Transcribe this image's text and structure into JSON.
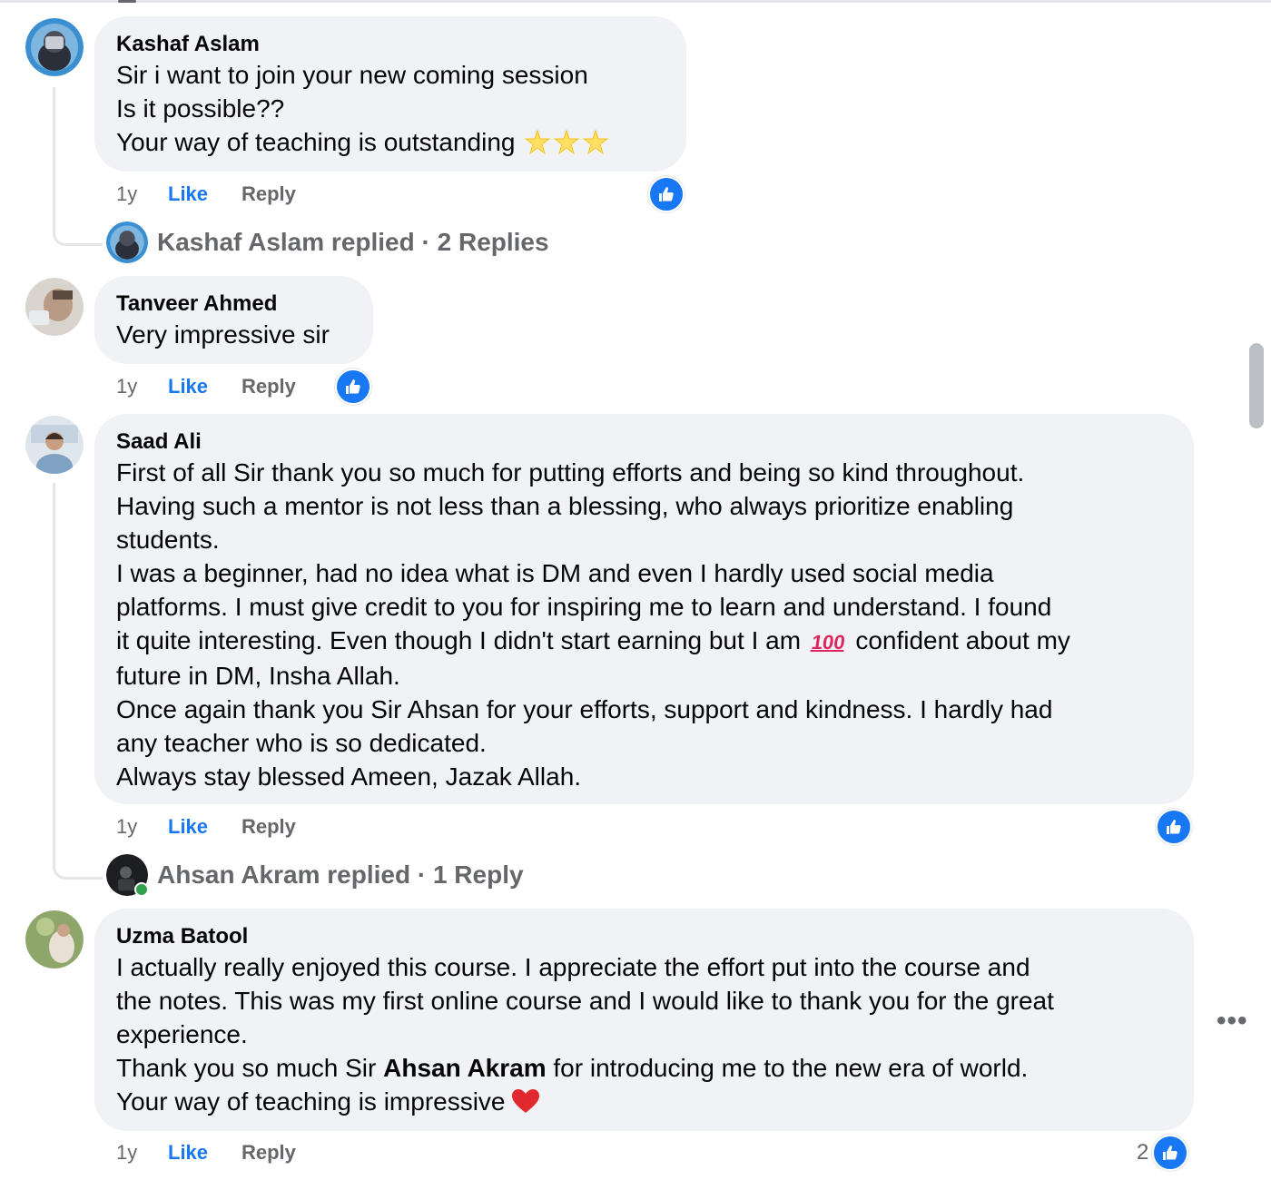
{
  "comments": [
    {
      "author": "Kashaf Aslam",
      "lines": [
        "Sir i want to join your new coming session",
        "Is it possible??",
        "Your way of teaching is outstanding"
      ],
      "time": "1y",
      "like": "Like",
      "reply": "Reply",
      "replies_summary": "Kashaf Aslam replied · 2 Replies"
    },
    {
      "author": "Tanveer Ahmed",
      "lines": [
        "Very impressive sir"
      ],
      "time": "1y",
      "like": "Like",
      "reply": "Reply"
    },
    {
      "author": "Saad Ali",
      "lines": [
        "First of all Sir thank you so much for putting efforts and being so kind throughout.",
        "Having such a mentor is not less than a blessing, who always prioritize enabling",
        "students.",
        "I was a beginner, had no idea what is DM and even I hardly used social media",
        "platforms. I must give credit to you for inspiring me to learn and understand. I found",
        "it quite interesting. Even though I didn't start earning but I am",
        "confident about my",
        "future in DM, Insha Allah.",
        "Once again thank you Sir Ahsan for your efforts, support and kindness. I hardly had",
        "any teacher who is so dedicated.",
        "Always stay blessed Ameen, Jazak Allah."
      ],
      "hundred_emoji": "100",
      "time": "1y",
      "like": "Like",
      "reply": "Reply",
      "replies_summary": "Ahsan Akram replied · 1 Reply"
    },
    {
      "author": "Uzma Batool",
      "lines": [
        "I actually really enjoyed this course. I appreciate the effort put into the course and",
        "the notes. This was my first online course and I would like to thank you for the great",
        "experience.",
        "Thank you so much Sir",
        "Ahsan Akram",
        "for introducing me to the new era of world.",
        "Your way of teaching is impressive"
      ],
      "time": "1y",
      "like": "Like",
      "reply": "Reply",
      "reaction_count": "2"
    }
  ],
  "more_label": "•••",
  "colors": {
    "accent": "#1877f2",
    "bubble": "#f0f2f5",
    "muted": "#65676b"
  }
}
